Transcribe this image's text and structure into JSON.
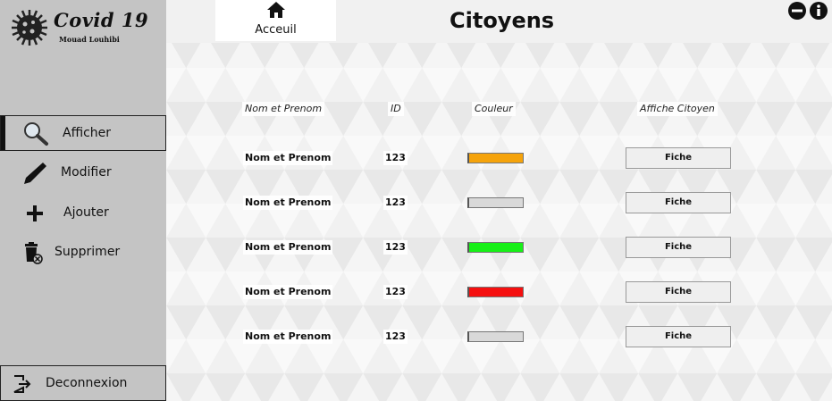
{
  "app": {
    "title": "Covid 19",
    "author": "Mouad Louhibi"
  },
  "sidebar": {
    "items": [
      {
        "label": "Afficher",
        "icon": "search-icon",
        "active": true
      },
      {
        "label": "Modifier",
        "icon": "pen-icon"
      },
      {
        "label": "Ajouter",
        "icon": "plus-icon"
      },
      {
        "label": "Supprimer",
        "icon": "trash-icon"
      }
    ],
    "logout_label": "Deconnexion"
  },
  "header": {
    "home_label": "Acceuil",
    "title": "Citoyens"
  },
  "table": {
    "columns": [
      "Nom et Prenom",
      "ID",
      "Couleur",
      "Affiche Citoyen"
    ],
    "rows": [
      {
        "name": "Nom et Prenom",
        "id": "123",
        "color": "#f5a30b",
        "action": "Fiche"
      },
      {
        "name": "Nom et Prenom",
        "id": "123",
        "color": "#d9d9d9",
        "action": "Fiche"
      },
      {
        "name": "Nom et Prenom",
        "id": "123",
        "color": "#17f017",
        "action": "Fiche"
      },
      {
        "name": "Nom et Prenom",
        "id": "123",
        "color": "#f51010",
        "action": "Fiche"
      },
      {
        "name": "Nom et Prenom",
        "id": "123",
        "color": "#d9d9d9",
        "action": "Fiche"
      }
    ]
  },
  "colors": {
    "sidebar_bg": "#c4c4c4",
    "topbar_bg": "#f1f1f1"
  }
}
